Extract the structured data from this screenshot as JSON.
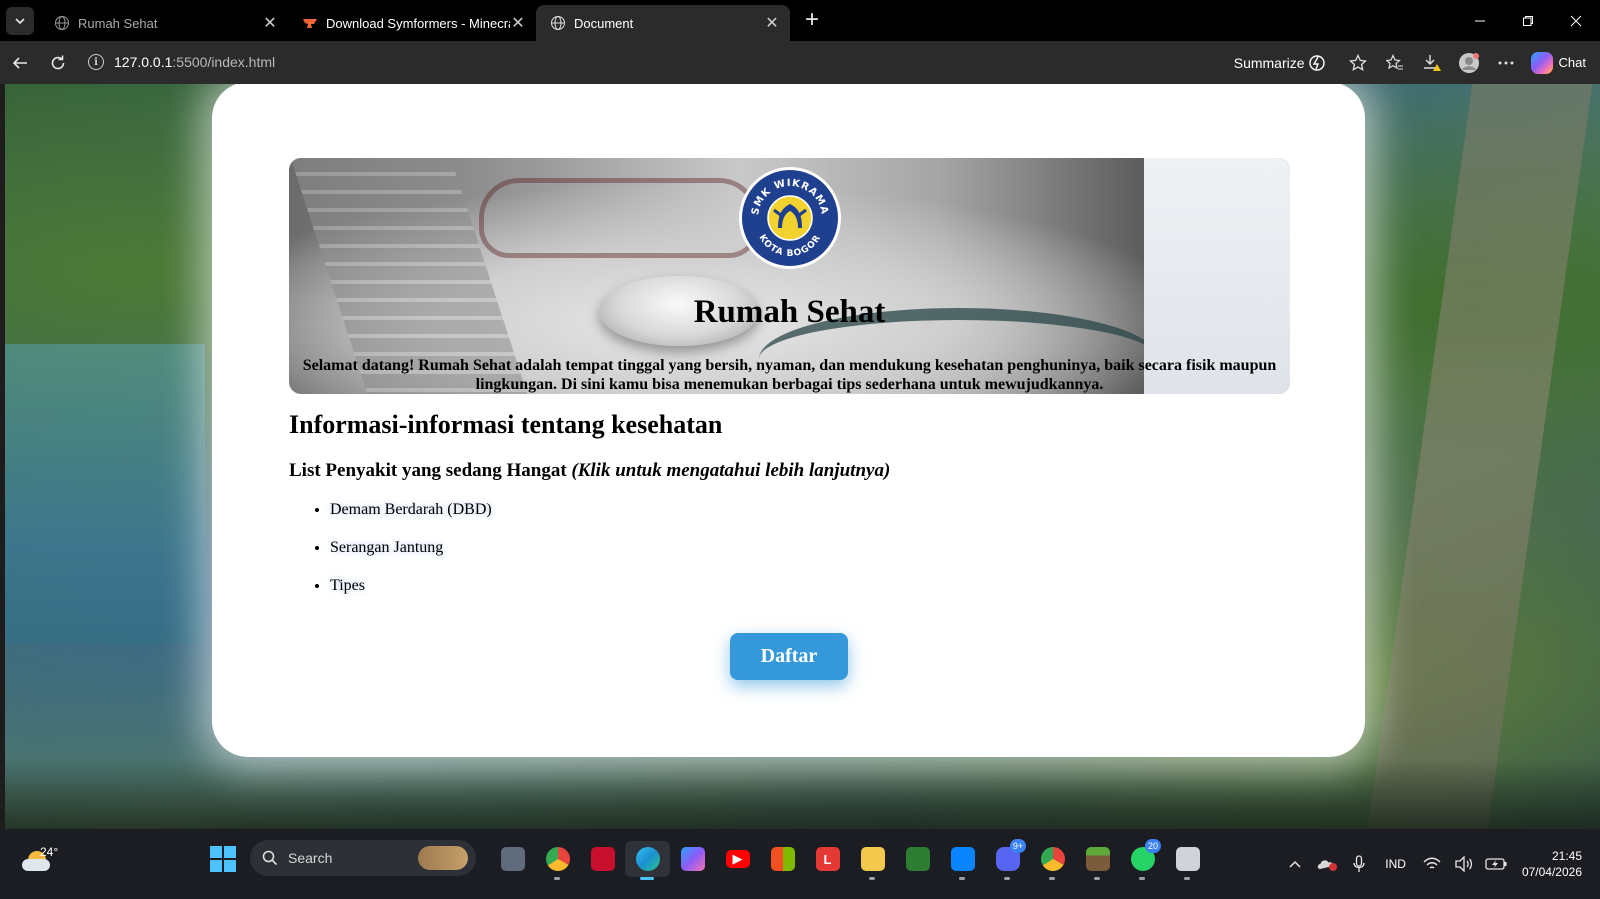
{
  "browser": {
    "tabs": [
      {
        "title": "Rumah Sehat",
        "state": "inactive",
        "icon": "globe-icon"
      },
      {
        "title": "Download Symformers - Minecraft",
        "state": "hovered",
        "icon": "curseforge-icon"
      },
      {
        "title": "Document",
        "state": "active",
        "icon": "globe-icon"
      }
    ],
    "tab_close_glyph": "✕",
    "new_tab_glyph": "+",
    "url_host": "127.0.0.1",
    "url_path": ":5500/index.html",
    "summarize_label": "Summarize",
    "chat_label": "Chat"
  },
  "page": {
    "hero_title": "Rumah Sehat",
    "hero_description": "Selamat datang! Rumah Sehat adalah tempat tinggal yang bersih, nyaman, dan mendukung kesehatan penghuninya, baik secara fisik maupun lingkungan. Di sini kamu bisa menemukan berbagai tips sederhana untuk mewujudkannya.",
    "logo_top_text": "SMK WIKRAMA",
    "logo_bottom_text": "KOTA BOGOR",
    "section_title": "Informasi-informasi tentang kesehatan",
    "list_title": "List Penyakit yang sedang Hangat",
    "list_hint": "(Klik untuk mengatahui lebih lanjutnya)",
    "diseases": [
      "Demam Berdarah (DBD)",
      "Serangan Jantung",
      "Tipes"
    ],
    "button_label": "Daftar",
    "button_color": "#3498db"
  },
  "taskbar": {
    "weather_temp": "24°",
    "search_placeholder": "Search",
    "apps": [
      {
        "name": "task-view-icon",
        "color": "#5f6b7a",
        "glyph": ""
      },
      {
        "name": "chrome-icon",
        "color": "#e8453c",
        "glyph": ""
      },
      {
        "name": "mcafee-icon",
        "color": "#c8102e",
        "glyph": ""
      },
      {
        "name": "edge-icon",
        "color": "#1b8fd1",
        "glyph": "",
        "active": true
      },
      {
        "name": "copilot-icon",
        "color": "#8b5cf6",
        "glyph": ""
      },
      {
        "name": "youtube-icon",
        "color": "#ff0000",
        "glyph": "▶"
      },
      {
        "name": "microsoft-store-icon",
        "color": "#f3b200",
        "glyph": ""
      },
      {
        "name": "lark-icon",
        "color": "#e53935",
        "glyph": "L"
      },
      {
        "name": "file-explorer-icon",
        "color": "#f2c94c",
        "glyph": ""
      },
      {
        "name": "minecraft-launcher-icon",
        "color": "#2e7d32",
        "glyph": ""
      },
      {
        "name": "vscode-icon",
        "color": "#0a84ff",
        "glyph": ""
      },
      {
        "name": "discord-icon",
        "color": "#5865f2",
        "glyph": "",
        "badge": "9+"
      },
      {
        "name": "chrome-profile-icon",
        "color": "#34a853",
        "glyph": ""
      },
      {
        "name": "minecraft-icon",
        "color": "#7a5c3b",
        "glyph": ""
      },
      {
        "name": "whatsapp-icon",
        "color": "#25d366",
        "glyph": "",
        "badge": "20"
      },
      {
        "name": "snipping-tool-icon",
        "color": "#d0d4da",
        "glyph": ""
      }
    ],
    "language": "IND",
    "time": "21:45",
    "date": "07/04/2026"
  }
}
